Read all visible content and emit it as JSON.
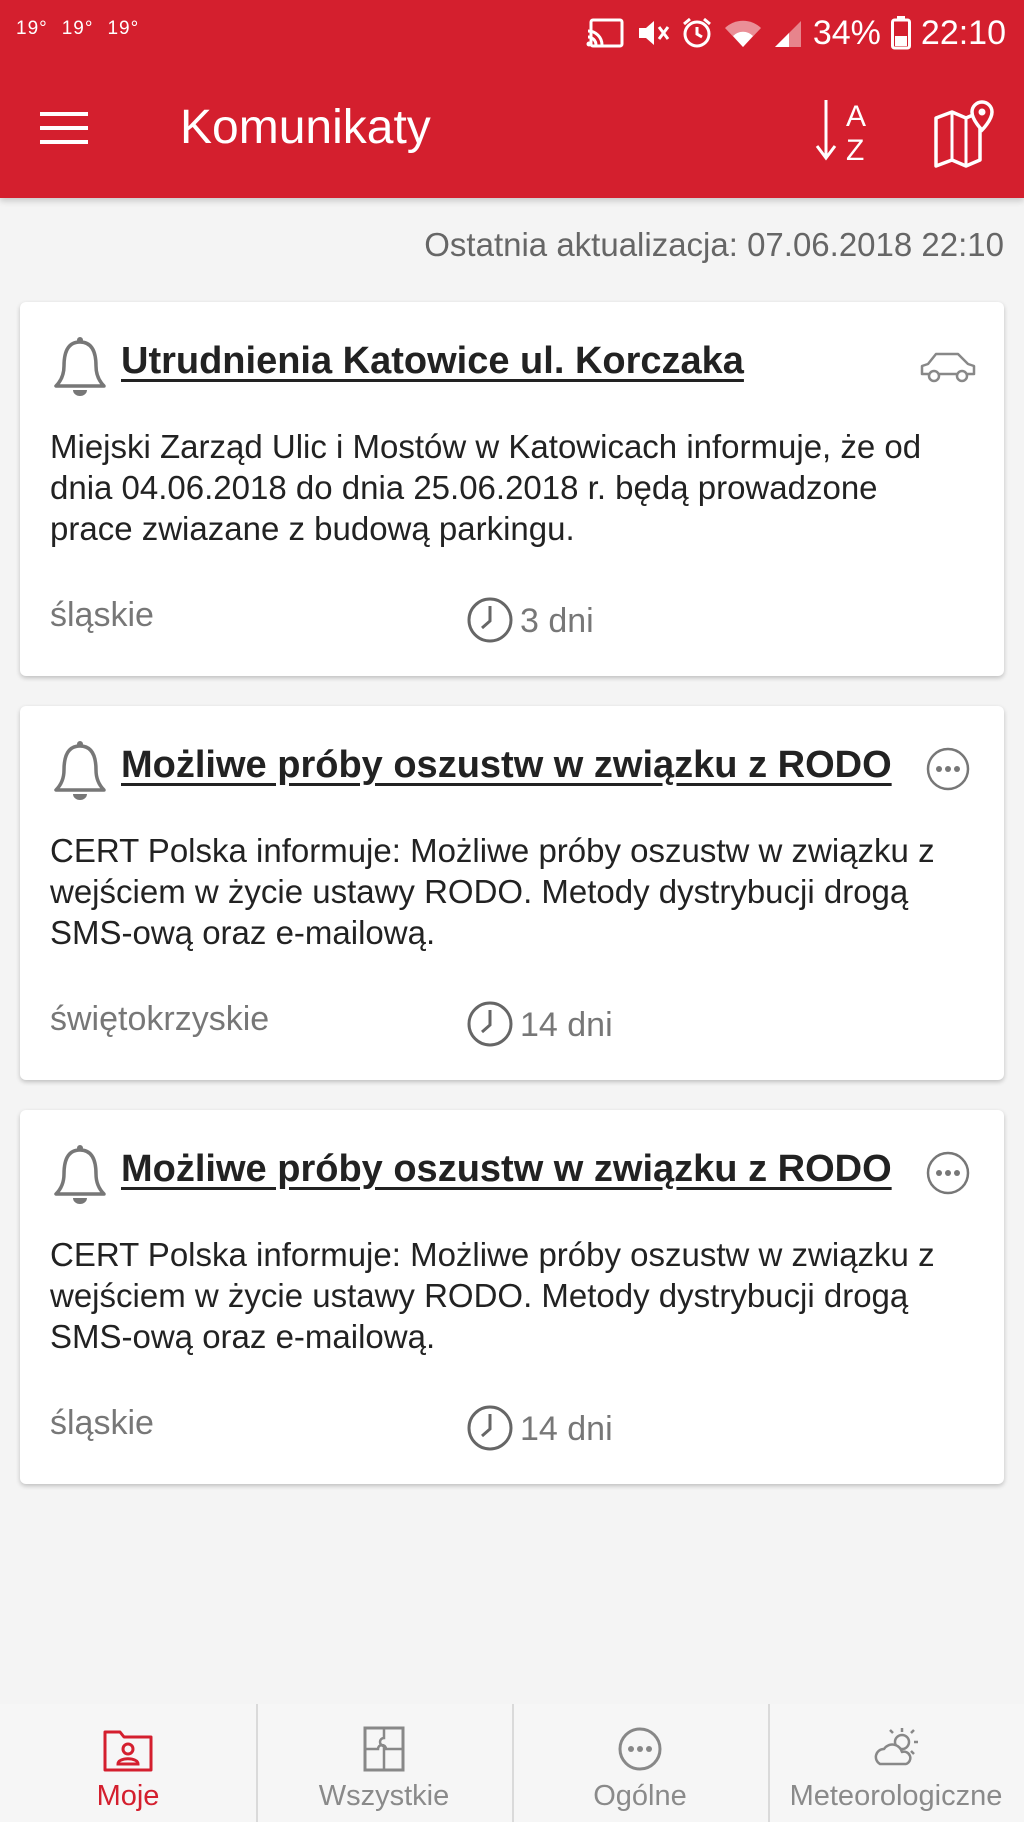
{
  "status_bar": {
    "temps": [
      "19°",
      "19°",
      "19°"
    ],
    "battery": "34%",
    "time": "22:10"
  },
  "toolbar": {
    "title": "Komunikaty",
    "sort_letters": [
      "A",
      "Z"
    ],
    "icons": {
      "menu": "menu-icon",
      "sort": "sort-az-icon",
      "map": "map-pin-icon"
    }
  },
  "last_update": "Ostatnia aktualizacja: 07.06.2018 22:10",
  "cards": [
    {
      "title": "Utrudnienia Katowice ul. Korczaka",
      "body": "Miejski Zarząd Ulic i Mostów w Katowicach informuje, że od dnia 04.06.2018 do dnia 25.06.2018 r. będą prowadzone prace zwiazane z budową parkingu.",
      "region": "śląskie",
      "duration": "3 dni",
      "type_icon": "car-icon"
    },
    {
      "title": "Możliwe próby oszustw w związku z RODO",
      "body": "CERT Polska informuje: Możliwe próby oszustw w związku z wejściem w życie ustawy RODO. Metody dystrybucji drogą SMS-ową oraz e-mailową.",
      "region": "świętokrzyskie",
      "duration": "14 dni",
      "type_icon": "more-icon"
    },
    {
      "title": "Możliwe próby oszustw w związku z RODO",
      "body": "CERT Polska informuje: Możliwe próby oszustw w związku z wejściem w życie ustawy RODO. Metody dystrybucji drogą SMS-ową oraz e-mailową.",
      "region": "śląskie",
      "duration": "14 dni",
      "type_icon": "more-icon"
    }
  ],
  "bottom_nav": [
    {
      "label": "Moje",
      "icon": "user-folder-icon",
      "active": true
    },
    {
      "label": "Wszystkie",
      "icon": "puzzle-icon",
      "active": false
    },
    {
      "label": "Ogólne",
      "icon": "more-circle-icon",
      "active": false
    },
    {
      "label": "Meteorologiczne",
      "icon": "weather-icon",
      "active": false
    }
  ],
  "colors": {
    "primary": "#d41f2e",
    "text": "#222222",
    "muted": "#777777"
  }
}
